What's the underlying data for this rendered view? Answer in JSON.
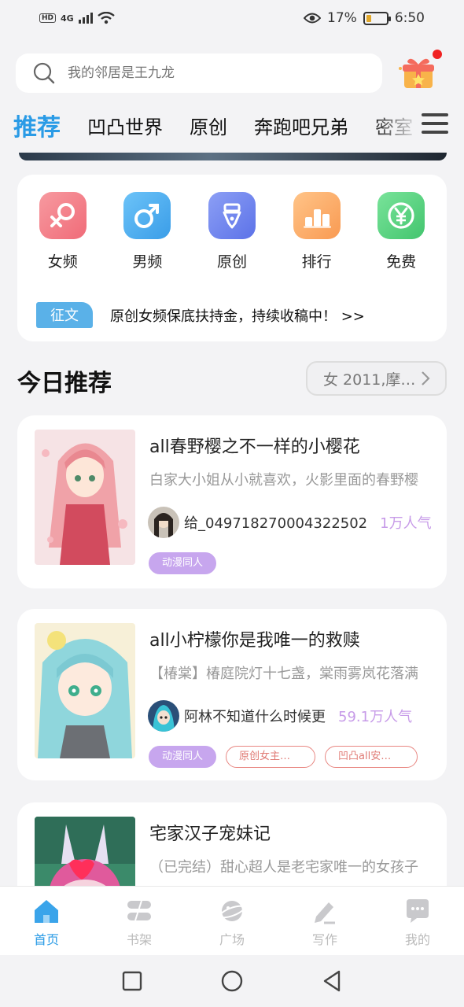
{
  "status": {
    "network": "4G",
    "hd": "HD",
    "battery": "17%",
    "time": "6:50"
  },
  "search": {
    "placeholder": "我的邻居是王九龙"
  },
  "tabs": [
    {
      "label": "推荐"
    },
    {
      "label": "凹凸世界"
    },
    {
      "label": "原创"
    },
    {
      "label": "奔跑吧兄弟"
    },
    {
      "label": "密室"
    }
  ],
  "categories": [
    {
      "label": "女频",
      "icon": "female-icon",
      "color": "#f37d86"
    },
    {
      "label": "男频",
      "icon": "male-icon",
      "color": "#4fb0f2"
    },
    {
      "label": "原创",
      "icon": "pen-nib-icon",
      "color": "#6f86f0"
    },
    {
      "label": "排行",
      "icon": "ranking-icon",
      "color": "#fbae6a"
    },
    {
      "label": "免费",
      "icon": "yen-icon",
      "color": "#5dd283"
    }
  ],
  "notice": {
    "tag": "征文",
    "text": "原创女频保底扶持金，持续收稿中！ >>"
  },
  "section": {
    "title": "今日推荐",
    "filter": "女 2011,摩…"
  },
  "books": [
    {
      "title": "all春野樱之不一样的小樱花",
      "desc": "白家大小姐从小就喜欢，火影里面的春野樱",
      "author": "给_049718270004322502",
      "popularity": "1万人气",
      "tags": [
        {
          "label": "动漫同人",
          "style": "purple"
        }
      ]
    },
    {
      "title": "all小柠檬你是我唯一的救赎",
      "desc": "【椿棠】椿庭院灯十七盏，棠雨雾岚花落满",
      "author": "阿林不知道什么时候更",
      "popularity": "59.1万人气",
      "tags": [
        {
          "label": "动漫同人",
          "style": "purple"
        },
        {
          "label": "原创女主…",
          "style": "red"
        },
        {
          "label": "凹凸all安…",
          "style": "red"
        }
      ]
    },
    {
      "title": "宅家汉子宠妹记",
      "desc": "（已完结）甜心超人是老宅家唯一的女孩子",
      "author": "",
      "popularity": "",
      "tags": []
    }
  ],
  "bottom_nav": [
    {
      "label": "首页",
      "icon": "home-icon",
      "active": true
    },
    {
      "label": "书架",
      "icon": "bookshelf-icon",
      "active": false
    },
    {
      "label": "广场",
      "icon": "planet-icon",
      "active": false
    },
    {
      "label": "写作",
      "icon": "pencil-icon",
      "active": false
    },
    {
      "label": "我的",
      "icon": "chat-bubble-icon",
      "active": false
    }
  ],
  "colors": {
    "accent": "#2a9be6",
    "popularity": "#c79be8",
    "tag_purple": "#c7a6ee",
    "tag_red": "#e07a74"
  }
}
